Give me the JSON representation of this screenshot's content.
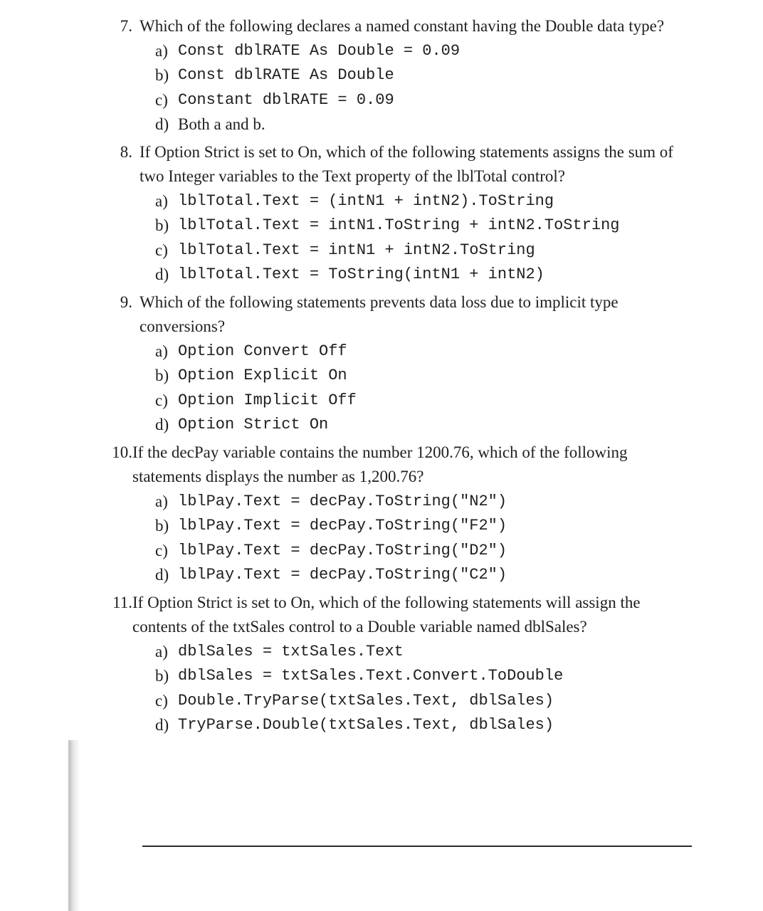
{
  "questions": [
    {
      "num": "7.",
      "text": "Which of the following declares a named constant having the Double data type?",
      "options": [
        {
          "letter": "a)",
          "code": "Const dblRATE As Double = 0.09"
        },
        {
          "letter": "b)",
          "code": "Const dblRATE As Double"
        },
        {
          "letter": "c)",
          "code": "Constant dblRATE = 0.09"
        },
        {
          "letter": "d)",
          "text": "Both a and b."
        }
      ]
    },
    {
      "num": "8.",
      "text": "If Option Strict is set to On, which of the following statements assigns the sum of two Integer variables to the Text property of the lblTotal control?",
      "options": [
        {
          "letter": "a)",
          "code": "lblTotal.Text = (intN1 + intN2).ToString"
        },
        {
          "letter": "b)",
          "code": "lblTotal.Text = intN1.ToString + intN2.ToString"
        },
        {
          "letter": "c)",
          "code": "lblTotal.Text = intN1 + intN2.ToString"
        },
        {
          "letter": "d)",
          "code": "lblTotal.Text = ToString(intN1 + intN2)"
        }
      ]
    },
    {
      "num": "9.",
      "text": "Which of the following statements prevents data loss due to implicit type conversions?",
      "options": [
        {
          "letter": "a)",
          "code": "Option Convert Off"
        },
        {
          "letter": "b)",
          "code": "Option Explicit On"
        },
        {
          "letter": "c)",
          "code": "Option Implicit Off"
        },
        {
          "letter": "d)",
          "code": "Option Strict On"
        }
      ]
    },
    {
      "num": "10.",
      "text": "If the decPay variable contains the number 1200.76, which of the following statements displays the number as 1,200.76?",
      "options": [
        {
          "letter": "a)",
          "code": "lblPay.Text = decPay.ToString(\"N2\")"
        },
        {
          "letter": "b)",
          "code": "lblPay.Text = decPay.ToString(\"F2\")"
        },
        {
          "letter": "c)",
          "code": "lblPay.Text = decPay.ToString(\"D2\")"
        },
        {
          "letter": "d)",
          "code": "lblPay.Text = decPay.ToString(\"C2\")"
        }
      ]
    },
    {
      "num": "11.",
      "text": "If Option Strict is set to On, which of the following statements will assign the contents of the txtSales control to a Double variable named dblSales?",
      "options": [
        {
          "letter": "a)",
          "code": "dblSales = txtSales.Text"
        },
        {
          "letter": "b)",
          "code": "dblSales = txtSales.Text.Convert.ToDouble"
        },
        {
          "letter": "c)",
          "code": "Double.TryParse(txtSales.Text, dblSales)"
        },
        {
          "letter": "d)",
          "code": "TryParse.Double(txtSales.Text, dblSales)"
        }
      ]
    }
  ]
}
